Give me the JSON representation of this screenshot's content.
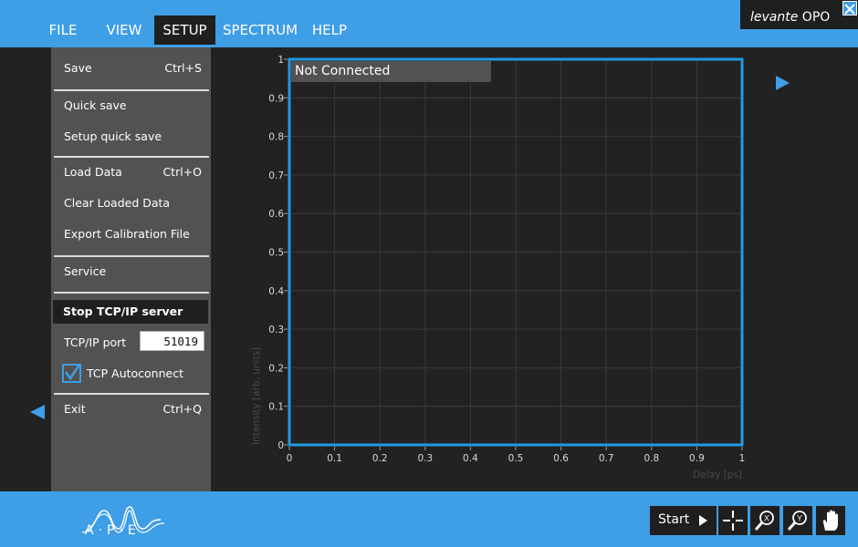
{
  "menu": {
    "items": [
      {
        "label": "FILE",
        "active": false
      },
      {
        "label": "VIEW",
        "active": false
      },
      {
        "label": "SETUP",
        "active": true
      },
      {
        "label": "SPECTRUM",
        "active": false
      },
      {
        "label": "HELP",
        "active": false
      }
    ]
  },
  "brand": {
    "italic": "levante",
    "rest": "OPO"
  },
  "dropdown": {
    "save": {
      "label": "Save",
      "shortcut": "Ctrl+S"
    },
    "quick_save": {
      "label": "Quick save"
    },
    "setup_quick_save": {
      "label": "Setup quick save"
    },
    "load_data": {
      "label": "Load Data",
      "shortcut": "Ctrl+O"
    },
    "clear_loaded_data": {
      "label": "Clear Loaded Data"
    },
    "export_calibration": {
      "label": "Export Calibration File"
    },
    "service": {
      "label": "Service"
    },
    "stop_tcp": {
      "label": "Stop TCP/IP server"
    },
    "tcp_port": {
      "label": "TCP/IP port",
      "value": "51019"
    },
    "tcp_autoconnect": {
      "label": "TCP Autoconnect",
      "checked": true
    },
    "exit": {
      "label": "Exit",
      "shortcut": "Ctrl+Q"
    }
  },
  "chart": {
    "status": "Not Connected",
    "xlabel": "Delay [ps]",
    "ylabel": "Intensity [arb. units]",
    "xlim": [
      0,
      1
    ],
    "ylim": [
      0,
      1
    ],
    "xticks": [
      "0",
      "0.1",
      "0.2",
      "0.3",
      "0.4",
      "0.5",
      "0.6",
      "0.7",
      "0.8",
      "0.9",
      "1"
    ],
    "yticks": [
      "0",
      "0.1",
      "0.2",
      "0.3",
      "0.4",
      "0.5",
      "0.6",
      "0.7",
      "0.8",
      "0.9",
      "1"
    ],
    "grid": true,
    "frame_color": "#1e9be3"
  },
  "toolbar": {
    "start_label": "Start",
    "icons": [
      "play-icon",
      "crosshair-icon",
      "zoom-x-icon",
      "zoom-y-icon",
      "pan-hand-icon"
    ]
  },
  "logo": {
    "text": "A·P·E"
  },
  "colors": {
    "accent": "#3e9ee6",
    "dark": "#1f1f1f",
    "menu_bg": "#525252",
    "background": "#222222"
  }
}
